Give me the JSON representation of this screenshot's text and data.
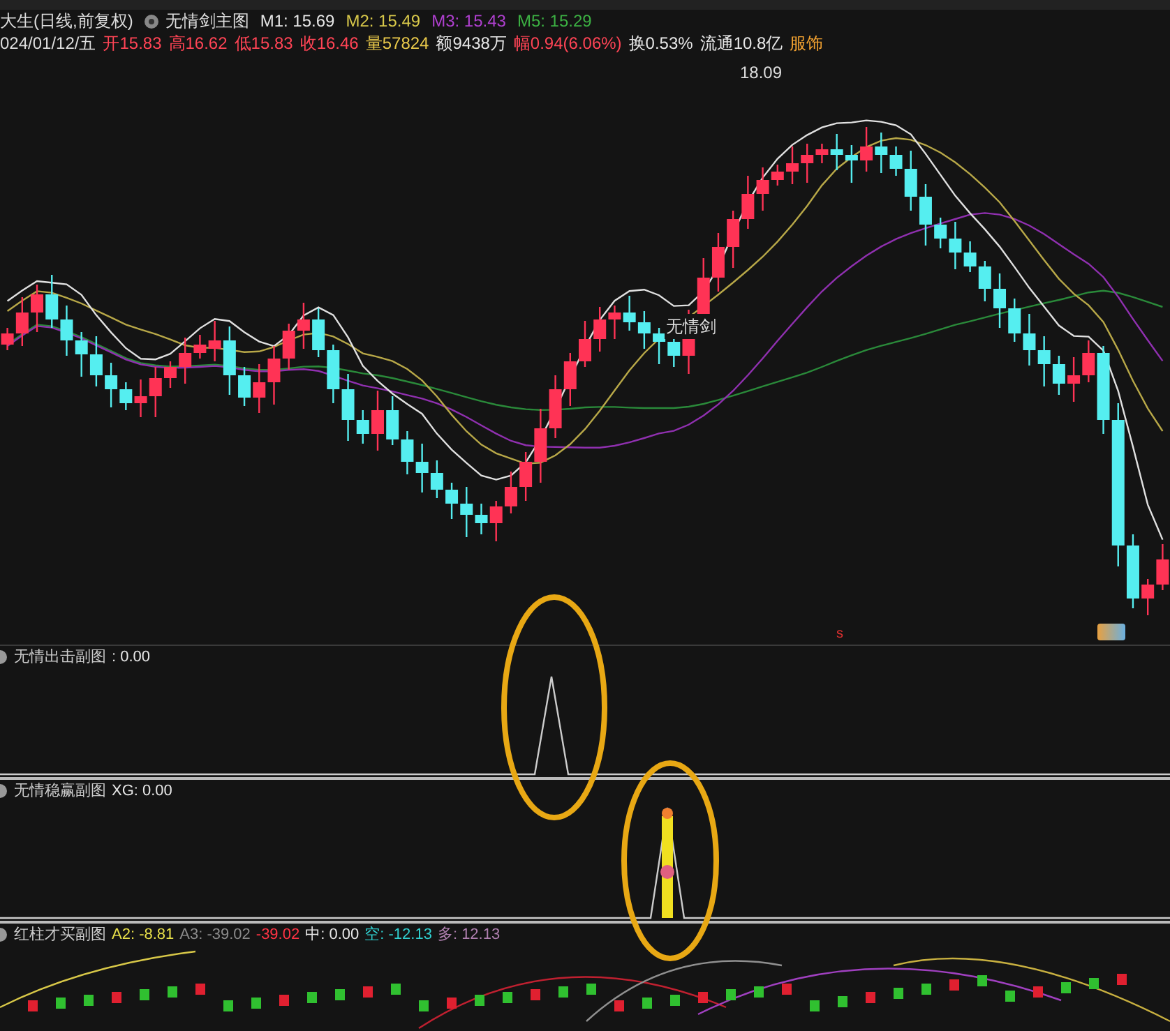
{
  "header": {
    "security": "大生(日线,前复权)",
    "main_indicator": "无情剑主图",
    "averages": [
      {
        "text": "M1: 15.69",
        "color": "#e6e6e6"
      },
      {
        "text": "M2: 15.49",
        "color": "#d8c84a"
      },
      {
        "text": "M3: 15.43",
        "color": "#b040d0"
      },
      {
        "text": "M5: 15.29",
        "color": "#3cb043"
      }
    ]
  },
  "quote": {
    "date": "024/01/12/五",
    "fields": [
      {
        "text": "开15.83",
        "color": "#ff4455"
      },
      {
        "text": "高16.62",
        "color": "#ff4455"
      },
      {
        "text": "低15.83",
        "color": "#ff4455"
      },
      {
        "text": "收16.46",
        "color": "#ff4455"
      },
      {
        "text": "量57824",
        "color": "#e8c84a"
      },
      {
        "text": "额9438万",
        "color": "#e6e6e6"
      },
      {
        "text": "幅0.94(6.06%)",
        "color": "#ff4455"
      },
      {
        "text": "换0.53%",
        "color": "#e6e6e6"
      },
      {
        "text": "流通10.8亿",
        "color": "#e6e6e6"
      },
      {
        "text": "服饰",
        "color": "#f0a030"
      }
    ]
  },
  "main_chart": {
    "high_label": "18.09",
    "signal_label": "无情剑",
    "marker": "s"
  },
  "panels": [
    {
      "title": "无情出击副图",
      "readings": [
        {
          "text": ": 0.00",
          "color": "#e6e6e6"
        }
      ]
    },
    {
      "title": "无情稳赢副图",
      "readings": [
        {
          "text": "XG: 0.00",
          "color": "#e6e6e6"
        }
      ]
    },
    {
      "title": "红柱才买副图",
      "readings": [
        {
          "text": "A2: -8.81",
          "color": "#e8e04a"
        },
        {
          "text": "A3: -39.02",
          "color": "#8a8a8a"
        },
        {
          "text": "-39.02",
          "color": "#ff3344"
        },
        {
          "text": "中: 0.00",
          "color": "#e6e6e6"
        },
        {
          "text": "空: -12.13",
          "color": "#30d0d0"
        },
        {
          "text": "多: 12.13",
          "color": "#b080b0"
        }
      ]
    }
  ]
}
